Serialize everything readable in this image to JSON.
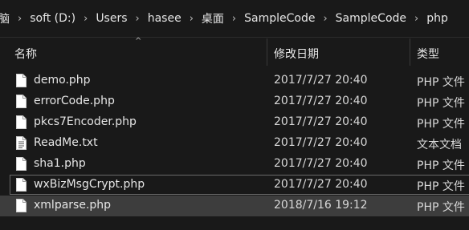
{
  "breadcrumb": {
    "items": [
      "脑",
      "soft (D:)",
      "Users",
      "hasee",
      "桌面",
      "SampleCode",
      "SampleCode",
      "php"
    ],
    "separator": "›"
  },
  "header": {
    "name": "名称",
    "date": "修改日期",
    "type": "类型",
    "sort_indicator": "^"
  },
  "files": [
    {
      "name": "demo.php",
      "date": "2017/7/27 20:40",
      "type": "PHP 文件",
      "icon": "php-file-icon"
    },
    {
      "name": "errorCode.php",
      "date": "2017/7/27 20:40",
      "type": "PHP 文件",
      "icon": "php-file-icon"
    },
    {
      "name": "pkcs7Encoder.php",
      "date": "2017/7/27 20:40",
      "type": "PHP 文件",
      "icon": "php-file-icon"
    },
    {
      "name": "ReadMe.txt",
      "date": "2017/7/27 20:40",
      "type": "文本文档",
      "icon": "text-file-icon"
    },
    {
      "name": "sha1.php",
      "date": "2017/7/27 20:40",
      "type": "PHP 文件",
      "icon": "php-file-icon"
    },
    {
      "name": "wxBizMsgCrypt.php",
      "date": "2017/7/27 20:40",
      "type": "PHP 文件",
      "icon": "php-file-icon"
    },
    {
      "name": "xmlparse.php",
      "date": "2018/7/16 19:12",
      "type": "PHP 文件",
      "icon": "php-file-icon"
    }
  ],
  "colors": {
    "background": "#191919",
    "selected": "#3d3d3d",
    "text": "#e6e6e6"
  }
}
